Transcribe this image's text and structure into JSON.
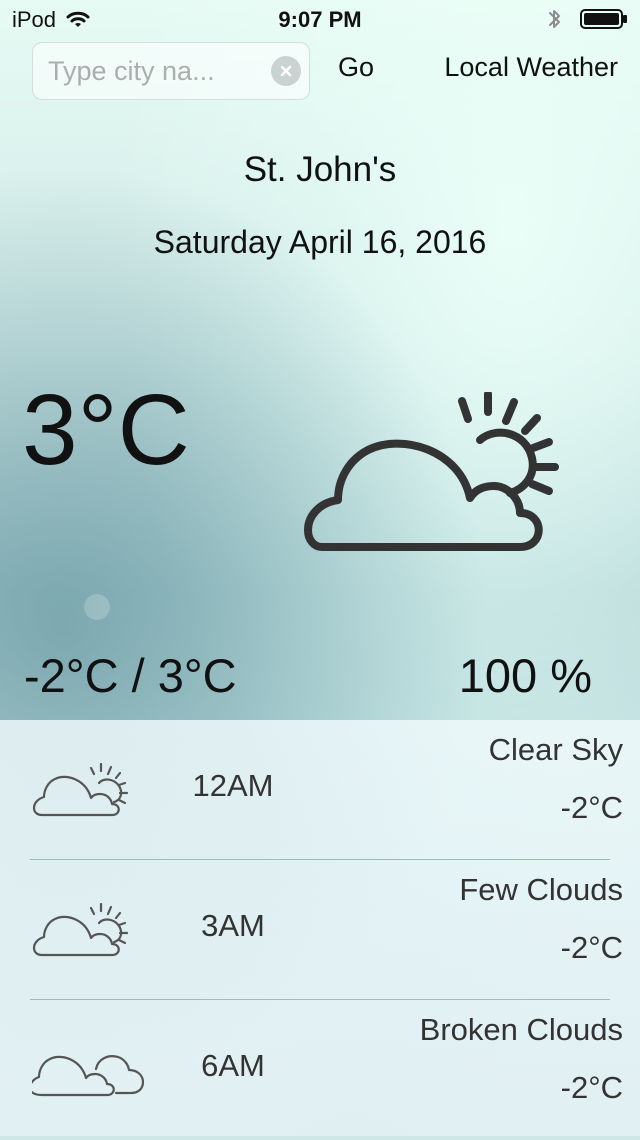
{
  "status_bar": {
    "device": "iPod",
    "time": "9:07 PM",
    "wifi_icon": "wifi-icon",
    "bluetooth_icon": "bluetooth-icon",
    "battery_icon": "battery-icon"
  },
  "search": {
    "placeholder": "Type city na...",
    "value": ""
  },
  "actions": {
    "go_label": "Go",
    "local_weather_label": "Local Weather"
  },
  "main": {
    "city": "St. John's",
    "date": "Saturday April 16, 2016",
    "temperature": "3°C",
    "range": "-2°C / 3°C",
    "humidity": "100 %",
    "icon": "partly-cloudy-icon"
  },
  "forecast": [
    {
      "time": "12AM",
      "description": "Clear Sky",
      "temperature": "-2°C",
      "icon": "partly-cloudy-icon"
    },
    {
      "time": "3AM",
      "description": "Few Clouds",
      "temperature": "-2°C",
      "icon": "partly-cloudy-icon"
    },
    {
      "time": "6AM",
      "description": "Broken Clouds",
      "temperature": "-2°C",
      "icon": "broken-clouds-icon"
    }
  ]
}
